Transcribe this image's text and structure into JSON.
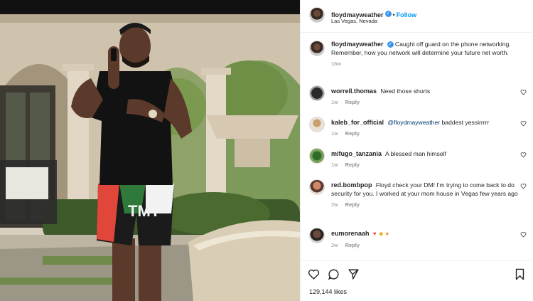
{
  "post": {
    "username": "floydmayweather",
    "follow_label": "Follow",
    "location": "Las Vegas, Nevada",
    "caption_text": "Caught off guard on the phone networking. Remember, how you network will determine your future net worth.",
    "caption_time": "16w",
    "likes": "129,144 likes"
  },
  "comments": [
    {
      "username": "worrell.thomas",
      "text": "Need those shorts",
      "time": "1w",
      "reply": "Reply"
    },
    {
      "username": "kaleb_for_official",
      "mention": "@floydmayweather",
      "text": "baddest yessirrrrr",
      "time": "1w",
      "reply": "Reply"
    },
    {
      "username": "mifugo_tanzania",
      "text": "A blessed man himself",
      "time": "1w",
      "reply": "Reply"
    },
    {
      "username": "red.bombpop",
      "text": "Floyd check your DM! I'm trying to come back to do security for you. I worked at your mom house in Vegas few years ago",
      "time": "2w",
      "reply": "Reply"
    },
    {
      "username": "eumorenaah",
      "text": "",
      "time": "2w",
      "reply": "Reply"
    }
  ],
  "photo": {
    "shorts_logo": "TMT"
  },
  "icons": {
    "verified": "verified-badge-icon",
    "more": "more-options-icon",
    "like": "heart-icon",
    "comment": "comment-icon",
    "share": "share-icon",
    "save": "bookmark-icon"
  },
  "colors": {
    "follow": "#0095f6",
    "verified": "#3897f0",
    "muted": "#8e8e8e",
    "text": "#262626"
  }
}
